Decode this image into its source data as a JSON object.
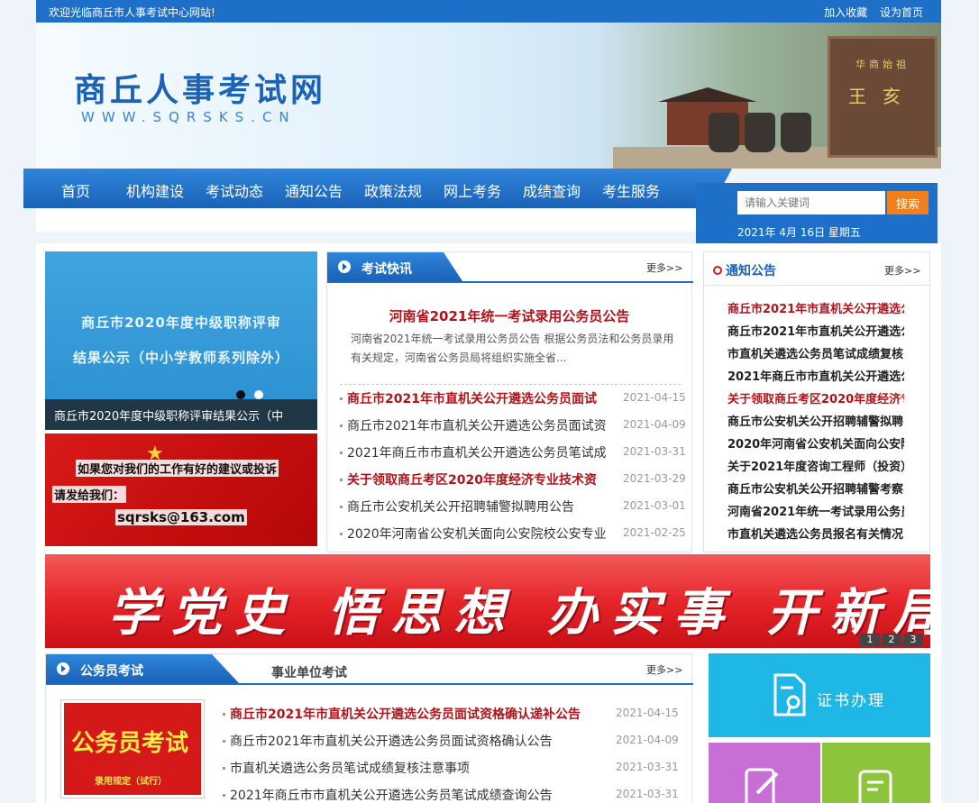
{
  "topbar": {
    "welcome": "欢迎光临商丘市人事考试中心网站!",
    "bookmark": "加入收藏",
    "set_home": "设为首页"
  },
  "banner": {
    "title": "商丘人事考试网",
    "url": "WWW.SQRSKS.CN",
    "stone_small": "华商始祖",
    "stone_big": "王亥"
  },
  "nav": {
    "items": [
      "首页",
      "机构建设",
      "考试动态",
      "通知公告",
      "政策法规",
      "网上考务",
      "成绩查询",
      "考生服务"
    ],
    "search_placeholder": "请输入关键词",
    "search_button": "搜索",
    "date": "2021年 4月 16日   星期五"
  },
  "slider": {
    "line1": "商丘市2020年度中级职称评审",
    "line2": "结果公示（中小学教师系列除外）",
    "caption": "商丘市2020年度中级职称评审结果公示（中"
  },
  "mailbox": {
    "line1": "如果您对我们的工作有好的建议或投诉",
    "line2": "请发给我们：",
    "email": "sqrsks@163.com"
  },
  "exam_news": {
    "title": "考试快讯",
    "more": "更多>>",
    "headline": "河南省2021年统一考试录用公务员公告",
    "summary": "河南省2021年统一考试录用公务员公告 根据公务员法和公务员录用有关规定，河南省公务员局将组织实施全省...",
    "items": [
      {
        "title": "商丘市2021年市直机关公开遴选公务员面试",
        "date": "2021-04-15",
        "hot": true
      },
      {
        "title": "商丘市2021年市直机关公开遴选公务员面试资",
        "date": "2021-04-09",
        "hot": false
      },
      {
        "title": "2021年商丘市市直机关公开遴选公务员笔试成",
        "date": "2021-03-31",
        "hot": false
      },
      {
        "title": "关于领取商丘考区2020年度经济专业技术资",
        "date": "2021-03-29",
        "hot": true
      },
      {
        "title": "商丘市公安机关公开招聘辅警拟聘用公告",
        "date": "2021-03-01",
        "hot": false
      },
      {
        "title": "2020年河南省公安机关面向公安院校公安专业",
        "date": "2021-02-25",
        "hot": false
      }
    ]
  },
  "notices": {
    "title": "通知公告",
    "more": "更多>>",
    "items": [
      {
        "title": "商丘市2021年市直机关公开遴选公",
        "hot": true
      },
      {
        "title": "商丘市2021年市直机关公开遴选公",
        "hot": false
      },
      {
        "title": "市直机关遴选公务员笔试成绩复核",
        "hot": false
      },
      {
        "title": "2021年商丘市市直机关公开遴选公",
        "hot": false
      },
      {
        "title": "关于领取商丘考区2020年度经济专",
        "hot": true
      },
      {
        "title": "商丘市公安机关公开招聘辅警拟聘",
        "hot": false
      },
      {
        "title": "2020年河南省公安机关面向公安院",
        "hot": false
      },
      {
        "title": "关于2021年度咨询工程师（投资）",
        "hot": false
      },
      {
        "title": "商丘市公安机关公开招聘辅警考察",
        "hot": false
      },
      {
        "title": "河南省2021年统一考试录用公务员",
        "hot": false
      },
      {
        "title": "市直机关遴选公务员报名有关情况",
        "hot": false
      }
    ]
  },
  "slogan": {
    "text": "学党史 悟思想 办实事 开新局",
    "pages": [
      "1",
      "2",
      "3"
    ]
  },
  "civil_exam": {
    "tab_active": "公务员考试",
    "tab_other": "事业单位考试",
    "more": "更多>>",
    "thumb_title": "公务员考试",
    "thumb_sub": "录用规定（试行）",
    "items": [
      {
        "title": "商丘市2021年市直机关公开遴选公务员面试资格确认递补公告",
        "date": "2021-04-15",
        "hot": true
      },
      {
        "title": "商丘市2021年市直机关公开遴选公务员面试资格确认公告",
        "date": "2021-04-09",
        "hot": false
      },
      {
        "title": "市直机关遴选公务员笔试成绩复核注意事项",
        "date": "2021-03-31",
        "hot": false
      },
      {
        "title": "2021年商丘市市直机关公开遴选公务员笔试成绩查询公告",
        "date": "2021-03-31",
        "hot": false
      }
    ]
  },
  "services": {
    "certificate": "证书办理",
    "colors": {
      "certificate": "#1fb8e6",
      "edit": "#c86fd6",
      "card": "#8cc43c"
    }
  }
}
